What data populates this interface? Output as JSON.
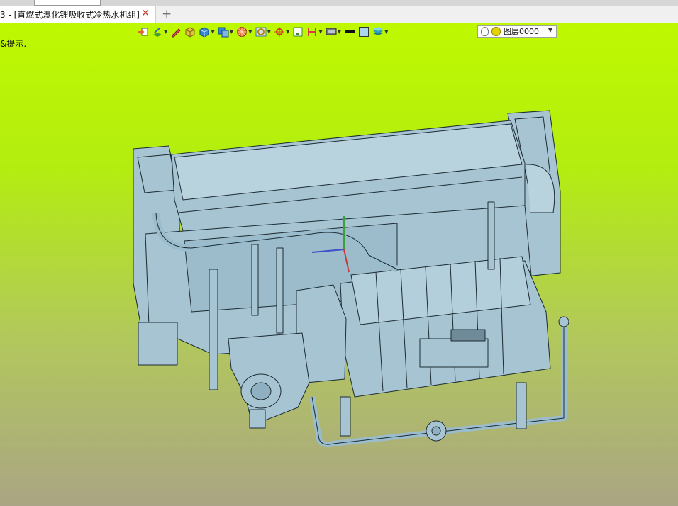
{
  "tab": {
    "title": "3 - [直燃式溴化锂吸收式冷热水机组]",
    "close_symbol": "✕",
    "new_symbol": "+"
  },
  "viewport": {
    "hint": "&提示."
  },
  "toolbar": {
    "buttons": [
      {
        "name": "import-icon",
        "color": "#e0633a"
      },
      {
        "name": "layer-draw-icon",
        "color": "#4a9a3a"
      },
      {
        "name": "pencil-icon",
        "color": "#d24b4b"
      },
      {
        "name": "box-yellow-icon",
        "color": "#e3c23c"
      },
      {
        "name": "cube-blue-icon",
        "color": "#2f86d1"
      },
      {
        "name": "cube-duplicate-icon",
        "color": "#2f86d1"
      },
      {
        "name": "pie-render-icon",
        "color": "#e56b2b"
      },
      {
        "name": "image-icon",
        "color": "#4a7a9a"
      },
      {
        "name": "axis-icon",
        "color": "#d23b2b"
      },
      {
        "name": "frame-icon",
        "color": "#3a8a3a"
      },
      {
        "name": "dimension-icon",
        "color": "#d24040"
      },
      {
        "name": "monitor-icon",
        "color": "#555555"
      },
      {
        "name": "line-weight-icon",
        "color": "#111111"
      },
      {
        "name": "fill-color-icon",
        "color": "#a9d7f0"
      },
      {
        "name": "layers-stack-icon",
        "color": "#2aa3b6"
      }
    ],
    "layer_selector": {
      "label": "图层0000"
    }
  },
  "colors": {
    "viewport_top": "#bef800",
    "viewport_bottom": "#aaa584",
    "model_fill": "#a6c4d2",
    "model_stroke": "#1d2b33"
  }
}
